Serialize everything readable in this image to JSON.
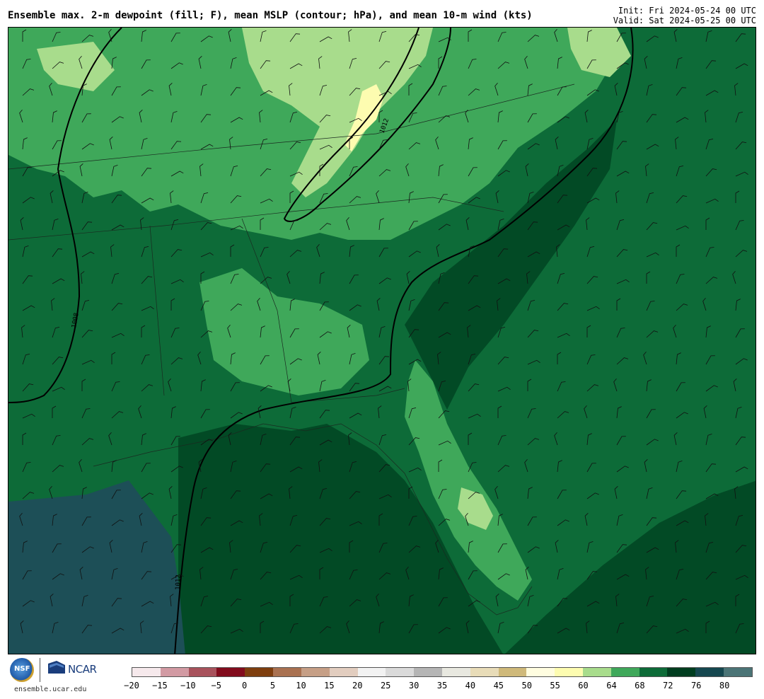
{
  "header": {
    "title": "Ensemble max. 2-m dewpoint (fill; F), mean MSLP (contour; hPa), and mean 10-m wind (kts)",
    "init": "Init: Fri 2024-05-24 00 UTC",
    "valid": "Valid: Sat 2024-05-25 00 UTC"
  },
  "contours": [
    {
      "label": "1012"
    },
    {
      "label": "1008"
    },
    {
      "label": "1012"
    }
  ],
  "footer": {
    "nsf_text": "NSF",
    "ncar_text": "NCAR",
    "site": "ensemble.ucar.edu"
  },
  "colorbar": {
    "colors": [
      "#f6e9ec",
      "#d29aa3",
      "#a8525c",
      "#820c1d",
      "#7e3e0e",
      "#a97151",
      "#c69f86",
      "#e2cdbf",
      "#f2f2f2",
      "#dadada",
      "#b5b5b5",
      "#e8e8e0",
      "#e8dcb8",
      "#cfb97a",
      "#fffde0",
      "#fdfcb0",
      "#a8dc8c",
      "#3fa85a",
      "#0d6b38",
      "#003d1f",
      "#15474f",
      "#4b7476"
    ],
    "ticks": [
      "−20",
      "−15",
      "−10",
      "−5",
      "0",
      "5",
      "10",
      "15",
      "20",
      "25",
      "30",
      "35",
      "40",
      "45",
      "50",
      "55",
      "60",
      "64",
      "68",
      "72",
      "76",
      "80"
    ]
  },
  "palette": {
    "dark_green": "#0d6b38",
    "very_dark_green": "#024a25",
    "mid_green": "#3fa85a",
    "light_green": "#a8dc8c",
    "pale_yellow": "#fdfcb0",
    "teal": "#1d4f57"
  }
}
